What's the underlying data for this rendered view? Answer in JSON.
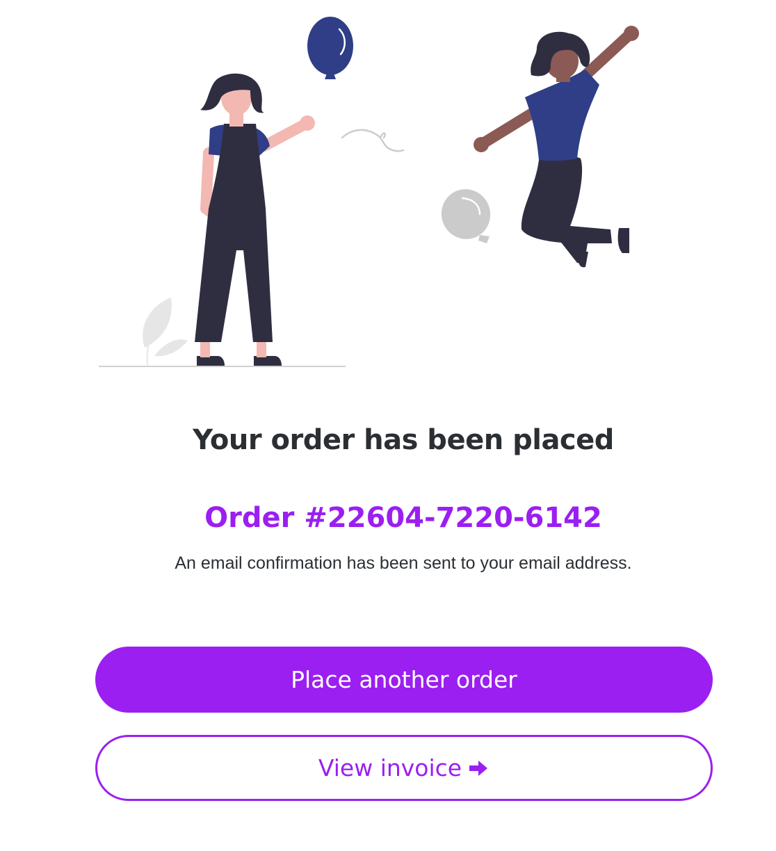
{
  "confirmation": {
    "title": "Your order has been placed",
    "order_number": "Order #22604-7220-6142",
    "message": "An email confirmation has been sent to your email address."
  },
  "actions": {
    "primary_label": "Place another order",
    "secondary_label": "View invoice",
    "secondary_icon": "arrow-right-icon"
  },
  "colors": {
    "accent": "#9b1ff0",
    "text": "#2b2f33",
    "illustration_blue": "#2f3e86",
    "illustration_dark": "#2f2e41",
    "illustration_gray": "#cbcbcb"
  }
}
